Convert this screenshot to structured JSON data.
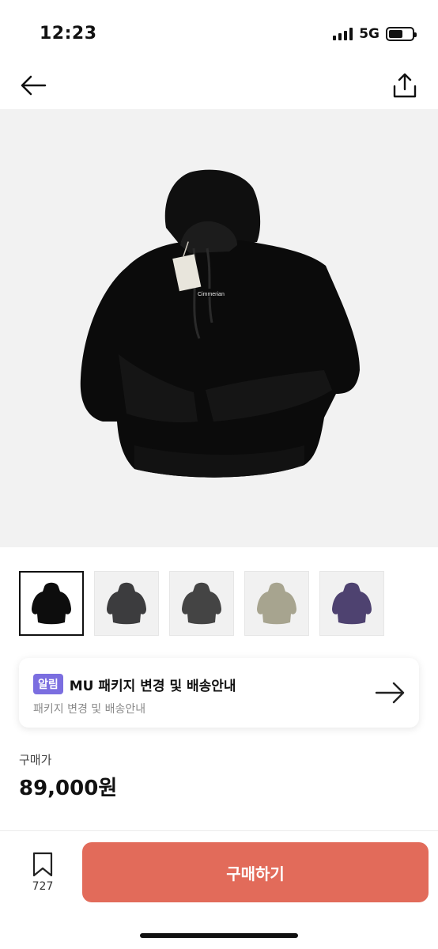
{
  "status_bar": {
    "time": "12:23",
    "network": "5G",
    "battery_level": 0.6
  },
  "nav": {
    "back_icon": "arrow-left-icon",
    "share_icon": "share-icon"
  },
  "product_image": {
    "brand_print": "Cimmerian"
  },
  "thumbnails": [
    {
      "color": "#0d0d0d",
      "icon": "hoodie-icon",
      "selected": true
    },
    {
      "color": "#3c3c3e",
      "icon": "hoodie-icon",
      "selected": false
    },
    {
      "color": "#444444",
      "icon": "hoodie-icon",
      "selected": false
    },
    {
      "color": "#a7a48f",
      "icon": "hoodie-icon",
      "selected": false
    },
    {
      "color": "#4e4270",
      "icon": "hoodie-icon",
      "selected": false
    }
  ],
  "notice": {
    "badge": "알림",
    "title": "MU 패키지 변경 및 배송안내",
    "subtitle": "패키지 변경 및 배송안내",
    "arrow_icon": "arrow-right-icon"
  },
  "price": {
    "label": "구매가",
    "value": "89,000원"
  },
  "bottom": {
    "bookmark_icon": "bookmark-icon",
    "bookmark_count": "727",
    "buy_label": "구매하기",
    "buy_color": "#e26b5a"
  },
  "colors": {
    "accent": "#e26b5a",
    "badge": "#7b6ee0"
  }
}
